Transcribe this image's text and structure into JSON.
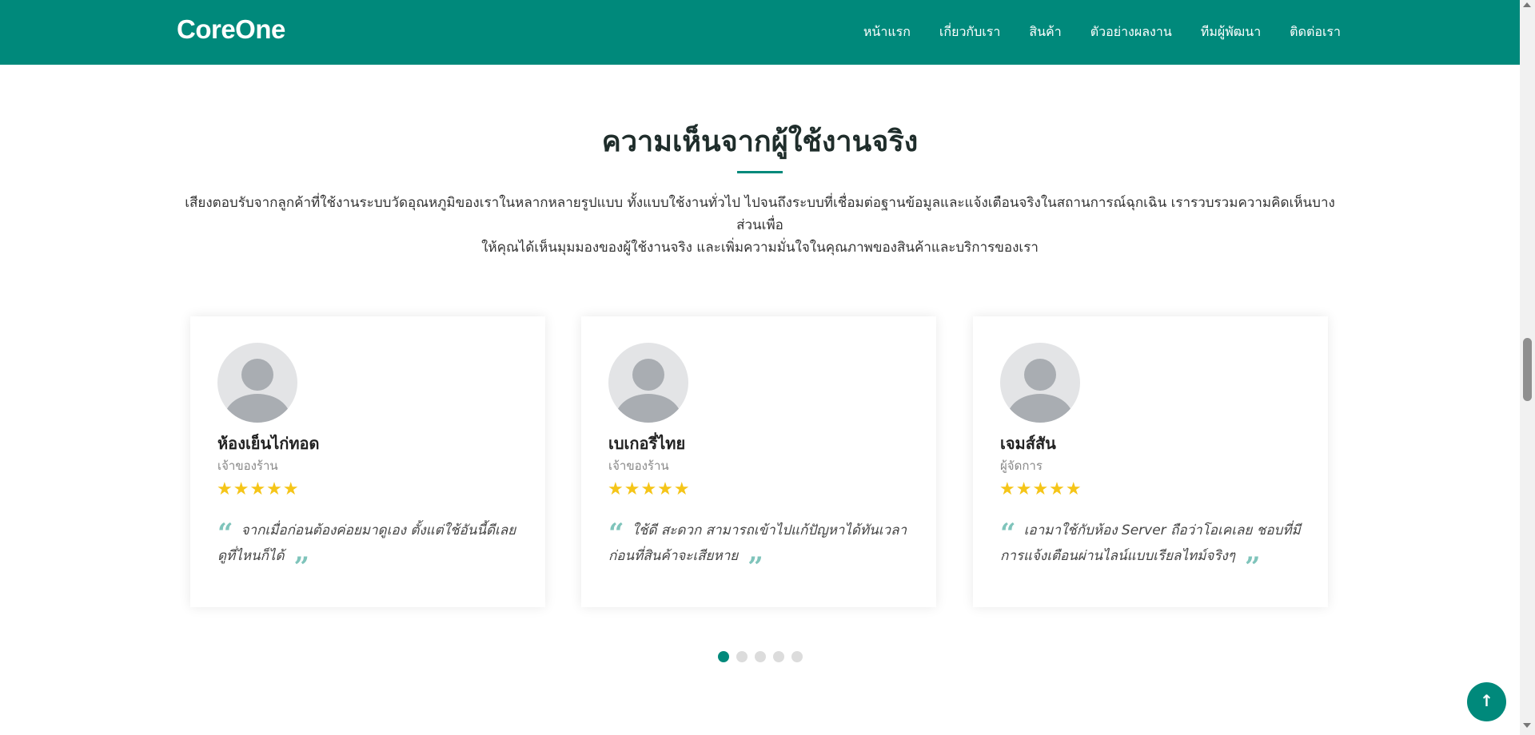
{
  "header": {
    "brand": "CoreOne",
    "nav": [
      "หน้าแรก",
      "เกี่ยวกับเรา",
      "สินค้า",
      "ตัวอย่างผลงาน",
      "ทีมผู้พัฒนา",
      "ติดต่อเรา"
    ]
  },
  "section": {
    "title": "ความเห็นจากผู้ใช้งานจริง",
    "desc_line1": "เสียงตอบรับจากลูกค้าที่ใช้งานระบบวัดอุณหภูมิของเราในหลากหลายรูปแบบ ทั้งแบบใช้งานทั่วไป ไปจนถึงระบบที่เชื่อมต่อฐานข้อมูลและแจ้งเตือนจริงในสถานการณ์ฉุกเฉิน เรารวบรวมความคิดเห็นบางส่วนเพื่อ",
    "desc_line2": "ให้คุณได้เห็นมุมมองของผู้ใช้งานจริง และเพิ่มความมั่นใจในคุณภาพของสินค้าและบริการของเรา"
  },
  "testimonials": [
    {
      "name": "ห้องเย็นไก่ทอด",
      "role": "เจ้าของร้าน",
      "stars": "★★★★★",
      "quote": "จากเมื่อก่อนต้องค่อยมาดูเอง ตั้งแต่ใช้อันนี้ดีเลย ดูที่ไหนก็ได้"
    },
    {
      "name": "เบเกอรี่ไทย",
      "role": "เจ้าของร้าน",
      "stars": "★★★★★",
      "quote": "ใช้ดี สะดวก สามารถเข้าไปแก้ปัญหาได้ทันเวลาก่อนที่สินค้าจะเสียหาย"
    },
    {
      "name": "เจมส์สัน",
      "role": "ผู้จัดการ",
      "stars": "★★★★★",
      "quote": "เอามาใช้กับห้อง Server ถือว่าโอเคเลย ชอบที่มีการแจ้งเตือนผ่านไลน์แบบเรียลไทม์จริงๆ"
    }
  ],
  "carousel": {
    "total_dots": 5,
    "active_index": 0
  },
  "icons": {
    "quote_open": "“",
    "quote_close": "”",
    "back_to_top": "↑"
  },
  "colors": {
    "primary": "#00897b",
    "star": "#f5c518",
    "quote_mark": "#7fc4bb"
  }
}
